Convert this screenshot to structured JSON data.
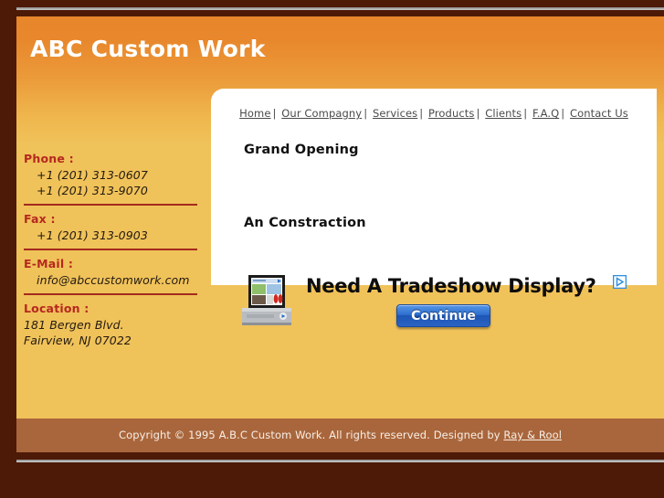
{
  "header": {
    "site_title": "ABC Custom Work"
  },
  "nav": {
    "separator": "|",
    "items": [
      {
        "label": "Home"
      },
      {
        "label": "Our Compagny"
      },
      {
        "label": "Services"
      },
      {
        "label": "Products"
      },
      {
        "label": "Clients"
      },
      {
        "label": "F.A.Q"
      },
      {
        "label": "Contact Us"
      }
    ]
  },
  "sidebar": {
    "phone": {
      "label": "Phone :",
      "values": [
        "+1 (201) 313-0607",
        "+1 (201) 313-9070"
      ]
    },
    "fax": {
      "label": "Fax :",
      "values": [
        "+1 (201) 313-0903"
      ]
    },
    "email": {
      "label": "E-Mail :",
      "values": [
        "info@abccustomwork.com"
      ]
    },
    "location": {
      "label": "Location :",
      "values": [
        "181 Bergen Blvd.",
        "Fairview, NJ 07022"
      ]
    }
  },
  "main": {
    "heading_1": "Grand Opening",
    "heading_2": "An Constraction"
  },
  "ad": {
    "headline": "Need A Tradeshow Display?",
    "button_label": "Continue",
    "adchoices_icon": "adchoices-triangle-icon",
    "kiosk_icon": "tradeshow-kiosk-image"
  },
  "footer": {
    "copyright": "Copyright © 1995 A.B.C Custom Work. All rights reserved. Designed by",
    "designer": "Ray & Rool"
  },
  "colors": {
    "outer_frame": "#4d1a08",
    "page_bg": "#f0c25a",
    "header_top": "#e8862b",
    "footer_bg": "#a9663c",
    "label_red": "#b5281f",
    "divider_red": "#a32a1c",
    "ad_button_blue": "#2f6fd0"
  }
}
